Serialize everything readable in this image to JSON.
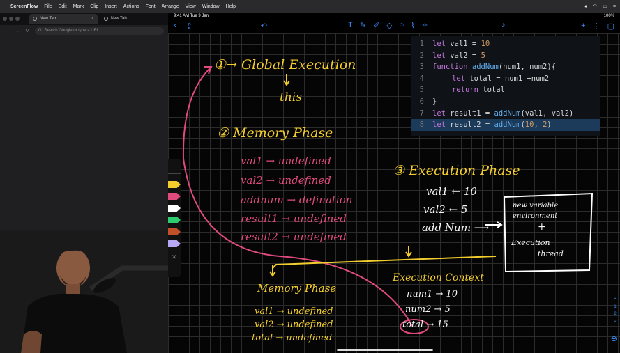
{
  "menubar": {
    "app_name": "ScreenFlow",
    "items": [
      "File",
      "Edit",
      "Mark",
      "Clip",
      "Insert",
      "Actions",
      "Font",
      "Arrange",
      "View",
      "Window",
      "Help"
    ]
  },
  "browser": {
    "tabs": [
      {
        "label": "New Tab",
        "close": "×"
      },
      {
        "label": "New Tab",
        "close": "×"
      }
    ],
    "omnibox_placeholder": "Search Google or type a URL"
  },
  "ipad": {
    "time": "9:41 AM  Tue 9 Jan",
    "battery": "100%"
  },
  "code": {
    "lines": [
      {
        "n": "1",
        "t": [
          [
            "kw",
            "let "
          ],
          [
            "tx",
            "val1 = "
          ],
          [
            "num",
            "10"
          ]
        ]
      },
      {
        "n": "2",
        "t": [
          [
            "kw",
            "let "
          ],
          [
            "tx",
            "val2 = "
          ],
          [
            "num",
            "5"
          ]
        ]
      },
      {
        "n": "3",
        "t": [
          [
            "kw",
            "function "
          ],
          [
            "fn",
            "addNum"
          ],
          [
            "tx",
            "(num1, num2){"
          ]
        ]
      },
      {
        "n": "4",
        "indent": true,
        "t": [
          [
            "kw",
            "let "
          ],
          [
            "tx",
            "total = num1 +num2"
          ]
        ]
      },
      {
        "n": "5",
        "indent": true,
        "t": [
          [
            "kw",
            "return "
          ],
          [
            "tx",
            "total"
          ]
        ]
      },
      {
        "n": "6",
        "t": [
          [
            "tx",
            "}"
          ]
        ]
      },
      {
        "n": "7",
        "t": [
          [
            "kw",
            "let "
          ],
          [
            "tx",
            "result1 = "
          ],
          [
            "fn",
            "addNum"
          ],
          [
            "tx",
            "(val1, val2)"
          ]
        ]
      },
      {
        "n": "8",
        "hl": true,
        "t": [
          [
            "kw",
            "let "
          ],
          [
            "tx",
            "result2 = "
          ],
          [
            "fn",
            "addNum"
          ],
          [
            "tx",
            "("
          ],
          [
            "num",
            "10"
          ],
          [
            "tx",
            ", "
          ],
          [
            "num",
            "2"
          ],
          [
            "tx",
            ")"
          ]
        ]
      }
    ]
  },
  "notes": {
    "global_execution": "①→ Global Execution",
    "this_label": "this",
    "memory_phase_title": "② Memory Phase",
    "memory_lines": [
      "val1 → undefined",
      "val2 → undefined",
      "addnum → defination",
      "result1 → undefined",
      "result2 → undefined"
    ],
    "execution_phase_title": "③ Execution Phase",
    "exec_val1": "val1 ← 10",
    "exec_val2": "val2 ← 5",
    "exec_addnum": "add Num ⟶",
    "box_line1": "new variable",
    "box_line2": "environment",
    "box_plus": "+",
    "box_line3": "Execution",
    "box_line4": "thread",
    "sub_memory_title": "Memory Phase",
    "sub_memory_lines": [
      "val1 → undefined",
      "val2 → undefined",
      "total → undefined"
    ],
    "exec_context_title": "Execution Context",
    "exec_context_lines": [
      "num1 → 10",
      "num2 → 5",
      "total → 15"
    ]
  },
  "pager": {
    "page": "1",
    "of": "2"
  }
}
